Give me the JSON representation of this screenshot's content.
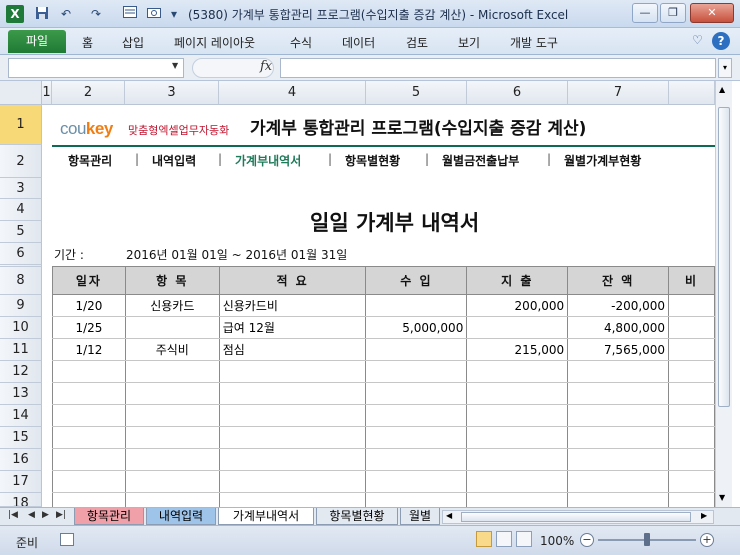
{
  "window": {
    "title": "(5380) 가계부 통합관리 프로그램(수입지출 증감 계산)  -  Microsoft Excel",
    "app_icon": "X",
    "min_label": "—",
    "max_label": "❐",
    "close_label": "✕"
  },
  "quick_access": {
    "save_icon": "floppy-disk-icon",
    "undo": "↶",
    "redo": "↷",
    "customize": "▾"
  },
  "ribbon": {
    "file_tab": "파일",
    "tabs": [
      "홈",
      "삽입",
      "페이지 레이아웃",
      "수식",
      "데이터",
      "검토",
      "보기",
      "개발 도구"
    ],
    "help": "?"
  },
  "formula_bar": {
    "name_box": "",
    "fx": "fx",
    "formula": ""
  },
  "columns": [
    "1",
    "2",
    "3",
    "4",
    "5",
    "6",
    "7"
  ],
  "rows": [
    "1",
    "2",
    "3",
    "4",
    "5",
    "6",
    "7",
    "8",
    "9",
    "10",
    "11",
    "12",
    "13",
    "14",
    "15",
    "16",
    "17",
    "18"
  ],
  "sheet": {
    "brand_cou": "cou",
    "brand_key": "key",
    "brand_sub": "맞춤형엑셀업무자동화",
    "program_title": "가계부 통합관리 프로그램(수입지출 증감 계산)",
    "nav": [
      "항목관리",
      "내역입력",
      "가계부내역서",
      "항목별현황",
      "월별금전출납부",
      "월별가계부현황"
    ],
    "nav_active": "가계부내역서",
    "doc_title": "일일 가계부 내역서",
    "period_label": "기간 :",
    "period_value": "2016년 01월 01일 ~ 2016년 01월 31일",
    "table": {
      "headers": [
        "일자",
        "항 목",
        "적 요",
        "수 입",
        "지 출",
        "잔 액",
        "비"
      ],
      "rows": [
        [
          "1/20",
          "신용카드",
          "신용카드비",
          "",
          "200,000",
          "-200,000",
          ""
        ],
        [
          "1/25",
          "",
          "급여 12월",
          "5,000,000",
          "",
          "4,800,000",
          ""
        ],
        [
          "1/12",
          "주식비",
          "점심",
          "",
          "215,000",
          "7,565,000",
          ""
        ],
        [
          "",
          "",
          "",
          "",
          "",
          "",
          ""
        ],
        [
          "",
          "",
          "",
          "",
          "",
          "",
          ""
        ],
        [
          "",
          "",
          "",
          "",
          "",
          "",
          ""
        ],
        [
          "",
          "",
          "",
          "",
          "",
          "",
          ""
        ],
        [
          "",
          "",
          "",
          "",
          "",
          "",
          ""
        ],
        [
          "",
          "",
          "",
          "",
          "",
          "",
          ""
        ],
        [
          "",
          "",
          "",
          "",
          "",
          "",
          ""
        ]
      ]
    }
  },
  "sheet_tabs": [
    "항목관리",
    "내역입력",
    "가계부내역서",
    "항목별현황",
    "월별"
  ],
  "sheet_tab_colors": [
    "#f0a0a8",
    "#9ec4ea",
    "#ffffff",
    "#e3e9f1",
    "#e3e9f1"
  ],
  "status": {
    "ready": "준비",
    "zoom": "100%",
    "zoom_out": "−",
    "zoom_in": "+"
  }
}
